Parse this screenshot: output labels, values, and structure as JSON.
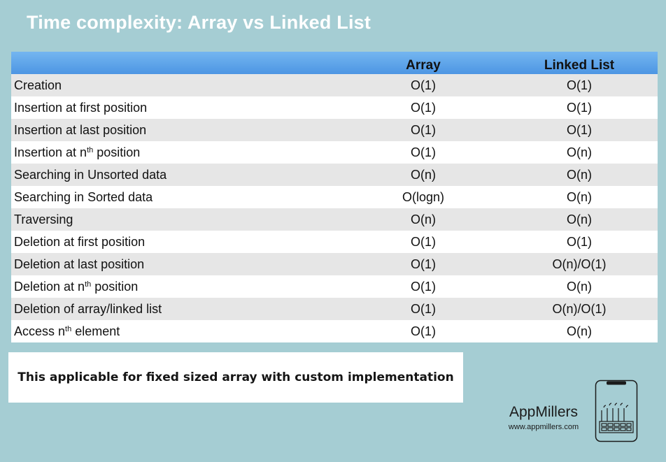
{
  "title": "Time complexity: Array vs Linked List",
  "table": {
    "headers": [
      "",
      "Array",
      "Linked List"
    ],
    "rows": [
      {
        "op": "Creation",
        "sup": "",
        "op_after": "",
        "array": "O(1)",
        "linked": "O(1)"
      },
      {
        "op": "Insertion at first position",
        "sup": "",
        "op_after": "",
        "array": "O(1)",
        "linked": "O(1)"
      },
      {
        "op": "Insertion at last position",
        "sup": "",
        "op_after": "",
        "array": "O(1)",
        "linked": "O(1)"
      },
      {
        "op": "Insertion at n",
        "sup": "th",
        "op_after": " position",
        "array": "O(1)",
        "linked": "O(n)"
      },
      {
        "op": "Searching in Unsorted data",
        "sup": "",
        "op_after": "",
        "array": "O(n)",
        "linked": "O(n)"
      },
      {
        "op": "Searching in Sorted data",
        "sup": "",
        "op_after": "",
        "array": "O(logn)",
        "linked": "O(n)"
      },
      {
        "op": "Traversing",
        "sup": "",
        "op_after": "",
        "array": "O(n)",
        "linked": "O(n)"
      },
      {
        "op": "Deletion at first position",
        "sup": "",
        "op_after": "",
        "array": "O(1)",
        "linked": "O(1)"
      },
      {
        "op": "Deletion at last position",
        "sup": "",
        "op_after": "",
        "array": "O(1)",
        "linked": "O(n)/O(1)"
      },
      {
        "op": "Deletion at n",
        "sup": "th",
        "op_after": " position",
        "array": "O(1)",
        "linked": "O(n)"
      },
      {
        "op": "Deletion of array/linked list",
        "sup": "",
        "op_after": "",
        "array": "O(1)",
        "linked": "O(n)/O(1)"
      },
      {
        "op": "Access n",
        "sup": "th",
        "op_after": " element",
        "array": "O(1)",
        "linked": "O(n)"
      }
    ]
  },
  "note": "This applicable for fixed sized array with custom implementation",
  "brand": {
    "name": "AppMillers",
    "url": "www.appmillers.com",
    "logo_icon": "factory-phone-icon"
  },
  "colors": {
    "background": "#a5cdd3",
    "header_top": "#74b6f0",
    "header_bottom": "#4d96e3",
    "row_alt": "#e6e6e6"
  }
}
